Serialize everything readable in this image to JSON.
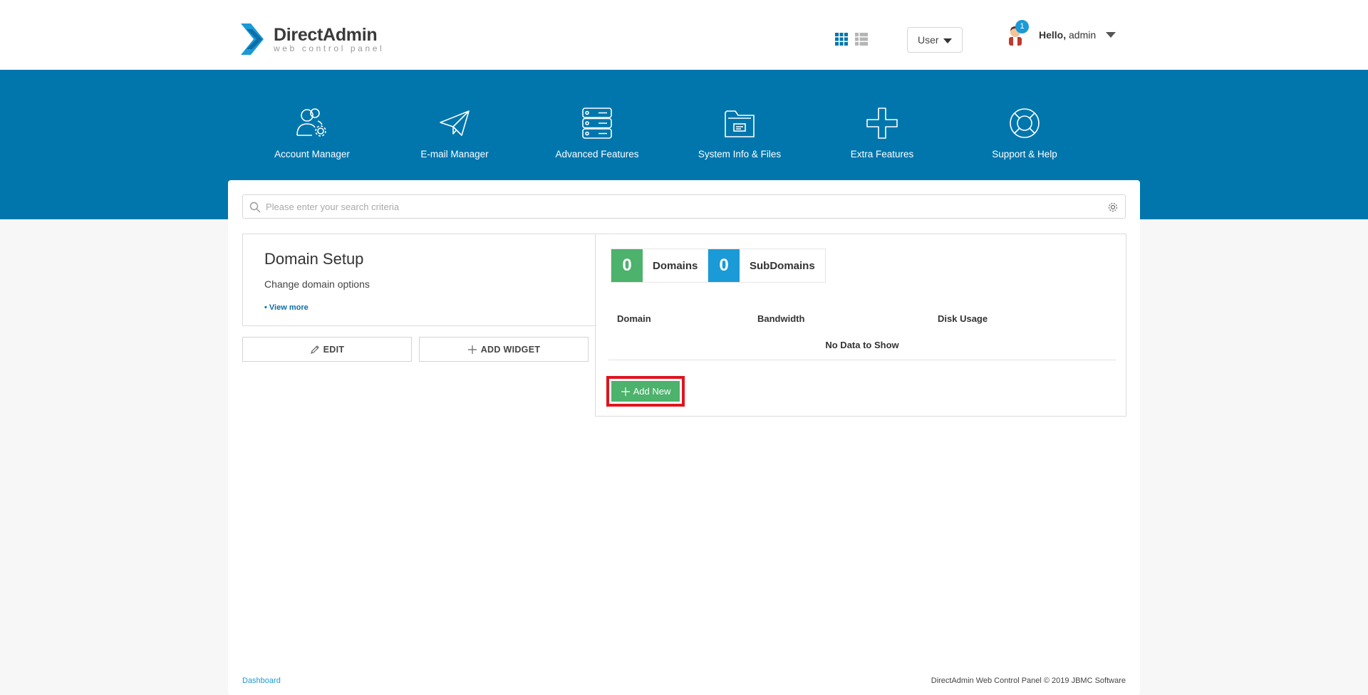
{
  "header": {
    "logo_title": "DirectAdmin",
    "logo_subtitle": "web control panel",
    "role_select": "User",
    "notification_count": "1",
    "greeting_bold": "Hello,",
    "greeting_user": " admin"
  },
  "nav": {
    "items": [
      {
        "label": "Account Manager",
        "icon": "account-manager-icon"
      },
      {
        "label": "E-mail Manager",
        "icon": "paper-plane-icon"
      },
      {
        "label": "Advanced Features",
        "icon": "server-stack-icon"
      },
      {
        "label": "System Info & Files",
        "icon": "folder-icon"
      },
      {
        "label": "Extra Features",
        "icon": "plus-icon"
      },
      {
        "label": "Support & Help",
        "icon": "lifebuoy-icon"
      }
    ]
  },
  "search": {
    "placeholder": "Please enter your search criteria",
    "value": ""
  },
  "widget": {
    "title": "Domain Setup",
    "description": "Change domain options",
    "view_more": "• View more",
    "edit_label": "EDIT",
    "add_widget_label": "ADD WIDGET"
  },
  "domains": {
    "domains_count": "0",
    "domains_label": "Domains",
    "subdomains_count": "0",
    "subdomains_label": "SubDomains",
    "columns": [
      "Domain",
      "Bandwidth",
      "Disk Usage"
    ],
    "empty_text": "No Data to Show",
    "add_new_label": "Add New"
  },
  "footer": {
    "breadcrumb": "Dashboard",
    "copyright": "DirectAdmin Web Control Panel © 2019 JBMC Software"
  },
  "colors": {
    "brand_blue": "#0076ad",
    "accent_blue": "#1a9ad6",
    "success_green": "#4cb26c",
    "highlight_red": "#e0141e"
  }
}
